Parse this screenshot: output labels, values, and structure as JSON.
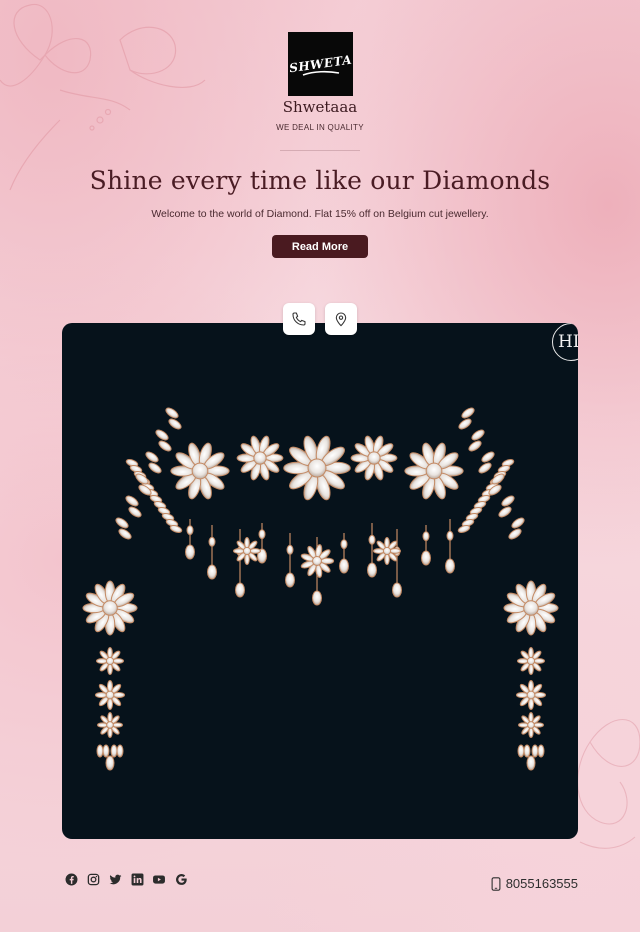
{
  "brand": {
    "logo_text": "SHWETA",
    "name": "Shwetaaa",
    "tagline": "WE DEAL IN QUALITY"
  },
  "hero_text": {
    "headline": "Shine every time like our Diamonds",
    "subline": "Welcome to the world of Diamond. Flat 15% off on Belgium cut jewellery.",
    "cta_label": "Read More"
  },
  "quick_actions": [
    {
      "icon": "phone-icon"
    },
    {
      "icon": "location-pin-icon"
    }
  ],
  "hero_image": {
    "watermark": "HL",
    "subject": "diamond-necklace-and-earrings"
  },
  "footer": {
    "social_icons": [
      "facebook-icon",
      "instagram-icon",
      "twitter-icon",
      "linkedin-icon",
      "youtube-icon",
      "google-icon"
    ],
    "phone": "8055163555"
  },
  "colors": {
    "accent": "#4a1a20",
    "hero_bg": "#06121b",
    "page_bg": "#f4cdd5"
  }
}
